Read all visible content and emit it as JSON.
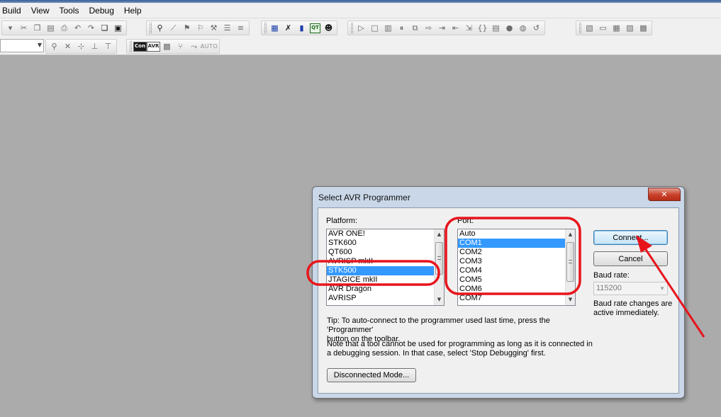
{
  "menu": {
    "items": [
      "Build",
      "View",
      "Tools",
      "Debug",
      "Help"
    ]
  },
  "toolbar": {
    "con_label": "Con",
    "avr_label": "AVR",
    "qt_label": "QT",
    "auto_label": "AUTO"
  },
  "dialog": {
    "title": "Select AVR Programmer",
    "close_glyph": "✕",
    "platform_label": "Platform:",
    "platform_items": [
      {
        "label": "AVR ONE!",
        "selected": false
      },
      {
        "label": "STK600",
        "selected": false
      },
      {
        "label": "QT600",
        "selected": false
      },
      {
        "label": "AVRISP mkII",
        "selected": false
      },
      {
        "label": "STK500",
        "selected": true
      },
      {
        "label": "JTAGICE mkII",
        "selected": false
      },
      {
        "label": "AVR Dragon",
        "selected": false
      },
      {
        "label": "AVRISP",
        "selected": false
      }
    ],
    "port_label": "Port:",
    "port_items": [
      {
        "label": "Auto",
        "selected": false
      },
      {
        "label": "COM1",
        "selected": true
      },
      {
        "label": "COM2",
        "selected": false
      },
      {
        "label": "COM3",
        "selected": false
      },
      {
        "label": "COM4",
        "selected": false
      },
      {
        "label": "COM5",
        "selected": false
      },
      {
        "label": "COM6",
        "selected": false
      },
      {
        "label": "COM7",
        "selected": false
      }
    ],
    "connect_label": "Connect...",
    "cancel_label": "Cancel",
    "baud_label": "Baud rate:",
    "baud_value": "115200",
    "baud_note_line1": "Baud rate changes are",
    "baud_note_line2": "active immediately.",
    "tip_line1": "Tip: To auto-connect to the programmer used last time, press the 'Programmer'",
    "tip_line2": "button on the toolbar.",
    "note_line1": "Note that a tool cannot be used for programming as long as it is connected in",
    "note_line2": "a debugging session. In that case, select 'Stop Debugging' first.",
    "disconnected_label": "Disconnected Mode..."
  },
  "colors": {
    "workspace": "#ababab",
    "selection": "#3399ff",
    "annotation": "#e8141c",
    "dialog_frame": "#c9d7e8"
  }
}
